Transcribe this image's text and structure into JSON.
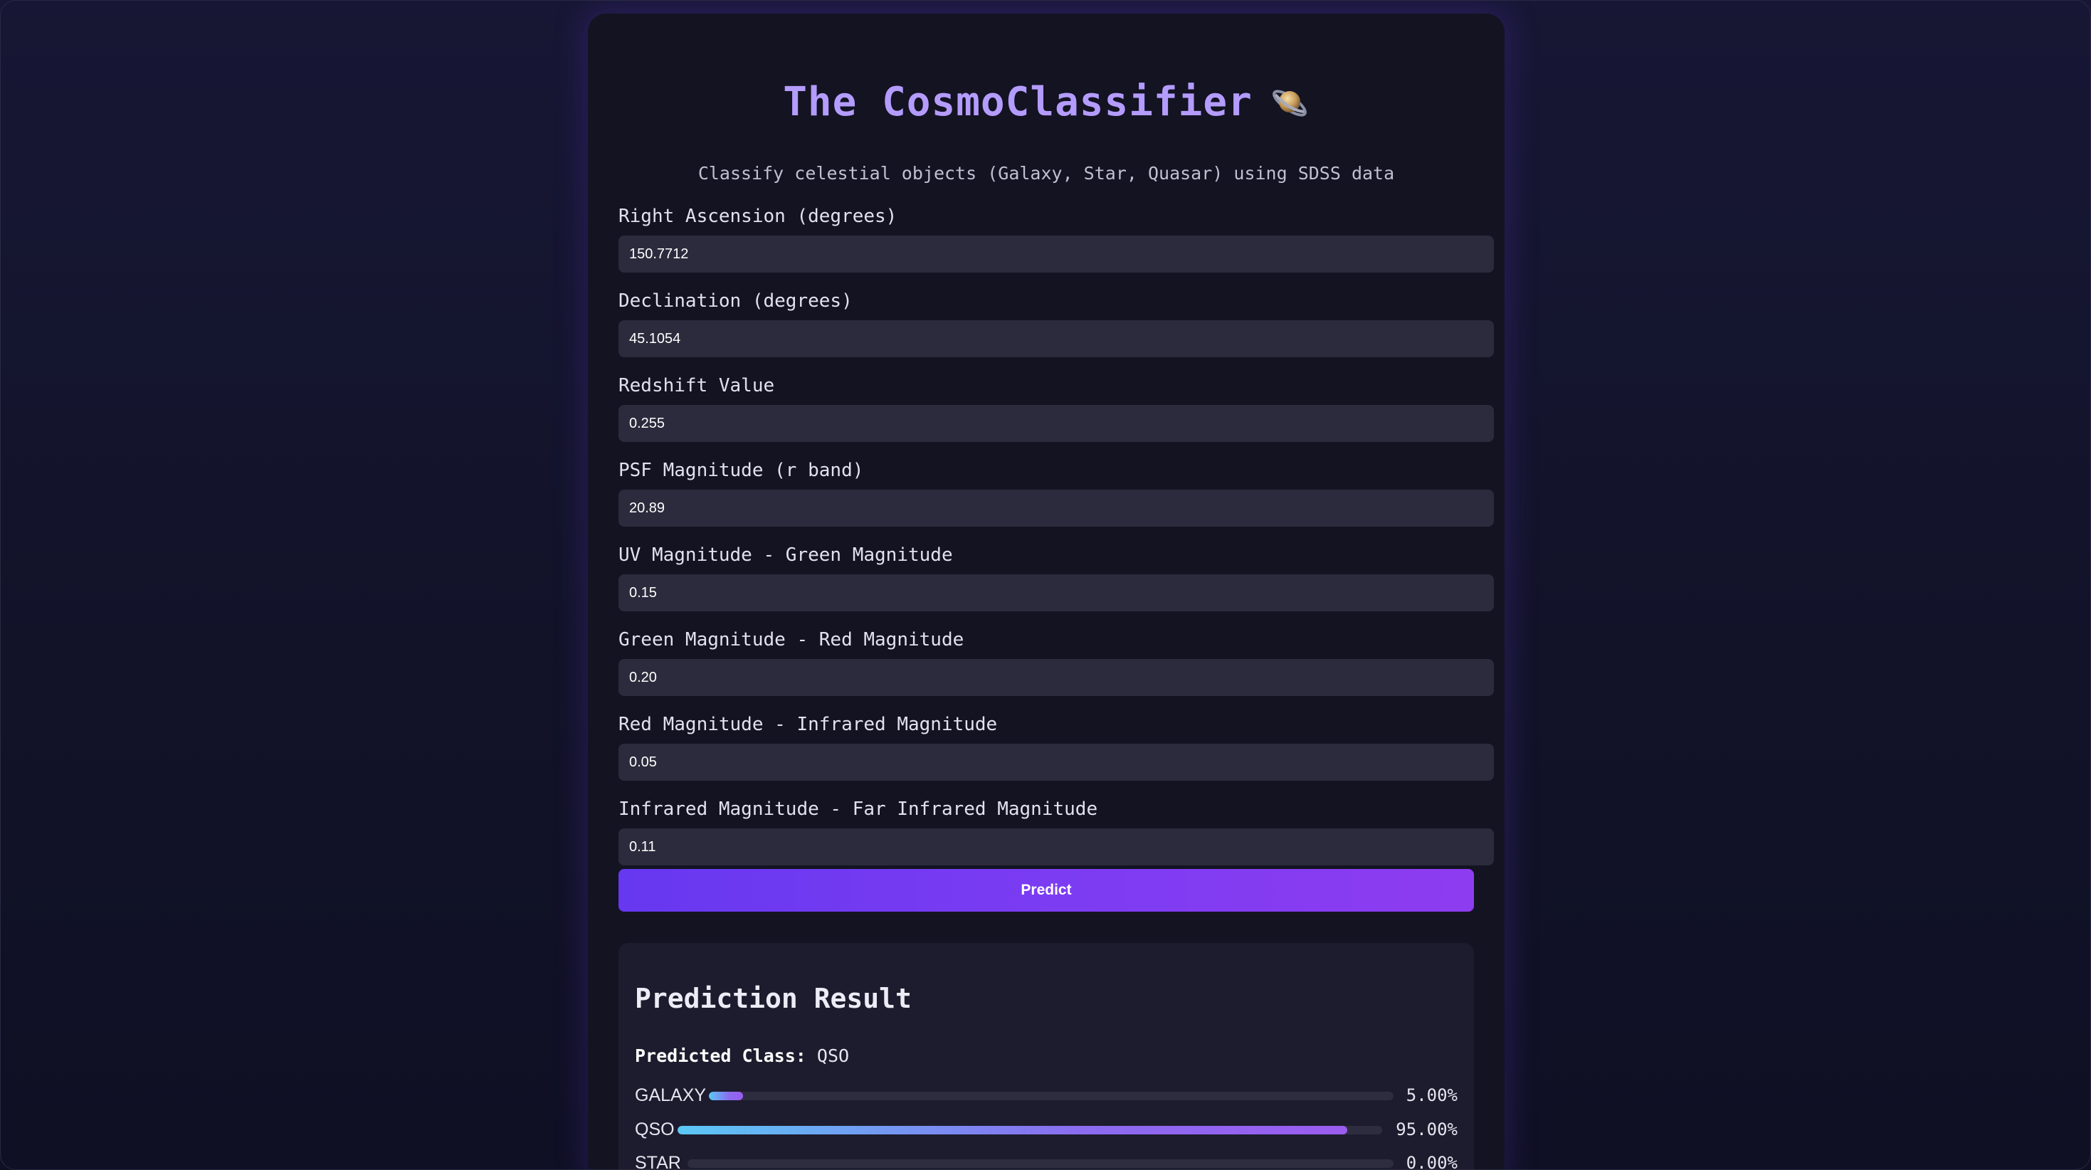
{
  "app": {
    "title": "The CosmoClassifier",
    "subtitle": "Classify celestial objects (Galaxy, Star, Quasar) using SDSS data",
    "title_icon": "ringed-planet-icon"
  },
  "form": {
    "fields": [
      {
        "label": "Right Ascension (degrees)",
        "value": "150.7712"
      },
      {
        "label": "Declination (degrees)",
        "value": "45.1054"
      },
      {
        "label": "Redshift Value",
        "value": "0.255"
      },
      {
        "label": "PSF Magnitude (r band)",
        "value": "20.89"
      },
      {
        "label": "UV Magnitude - Green Magnitude",
        "value": "0.15"
      },
      {
        "label": "Green Magnitude - Red Magnitude",
        "value": "0.20"
      },
      {
        "label": "Red Magnitude - Infrared Magnitude",
        "value": "0.05"
      },
      {
        "label": "Infrared Magnitude - Far Infrared Magnitude",
        "value": "0.11"
      }
    ],
    "predict_label": "Predict"
  },
  "result": {
    "title": "Prediction Result",
    "predicted_class_label": "Predicted Class:",
    "predicted_class_value": "QSO",
    "probabilities": [
      {
        "label": "GALAXY",
        "value": 5.0,
        "text": "5.00%"
      },
      {
        "label": "QSO",
        "value": 95.0,
        "text": "95.00%"
      },
      {
        "label": "STAR",
        "value": 0.0,
        "text": "0.00%"
      }
    ]
  },
  "colors": {
    "accent": "#b49cff",
    "button_start": "#6638f0",
    "button_end": "#8e3cf0",
    "background": "#131322"
  }
}
